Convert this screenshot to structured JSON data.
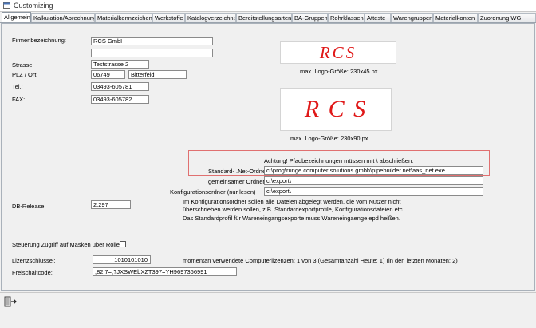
{
  "window": {
    "title": "Customizing"
  },
  "tabs": [
    "Allgemein",
    "Kalkulation/Abrechnung",
    "Materialkennzeichen",
    "Werkstoffe",
    "Katalogverzeichnis",
    "Bereitstellungsarten",
    "BA-Gruppen",
    "Rohrklassen",
    "Atteste",
    "Warengruppen",
    "Materialkonten",
    "Zuordnung WG"
  ],
  "form": {
    "firmenbezeichnung_label": "Firmenbezeichnung:",
    "firmenbezeichnung": "RCS GmbH",
    "firmenbezeichnung2": "",
    "strasse_label": "Strasse:",
    "strasse": "Teststrasse 2",
    "plz_ort_label": "PLZ / Ort:",
    "plz": "06749",
    "ort": "Bitterfeld",
    "tel_label": "Tel.:",
    "tel": "03493-605781",
    "fax_label": "FAX:",
    "fax": "03493-605782"
  },
  "logos": {
    "small_text": "RCS",
    "small_caption": "max. Logo-Größe: 230x45 px",
    "large_text": "R C S",
    "large_caption": "max. Logo-Größe: 230x90 px"
  },
  "paths": {
    "warning": "Achtung! Pfadbezeichnungen müssen mit \\ abschließen.",
    "net_label": "Standard- .Net-Ordner",
    "net_value": "c:\\prog\\runge computer solutions gmbh\\pipebuilder.net\\aas_net.exe",
    "shared_label": "gemeinsamer Ordner",
    "shared_value": "c:\\export\\",
    "config_label": "Konfigurationsordner (nur lesen)",
    "config_value": "c:\\export\\"
  },
  "db": {
    "label": "DB-Release:",
    "value": "2.297",
    "info1": "Im Konfigurationsordner sollen alle Dateien abgelegt werden, die vom Nutzer nicht",
    "info2": "überschrieben werden sollen, z.B. Standardexportprofile, Konfigurationsdateien etc.",
    "info3": "Das Standardprofil für Wareneingangsexporte muss Wareneingaenge.epd heißen."
  },
  "access": {
    "label": "Steuerung Zugriff auf Masken über Rollen",
    "checked": false
  },
  "license": {
    "key_label": "Lizenzschlüssel:",
    "key_value": "1010101010",
    "usage": "momentan verwendete Computerlizenzen: 1 von 3  (Gesamtanzahl Heute: 1)  (in den letzten Monaten: 2)",
    "code_label": "Freischaltcode:",
    "code_value": ";82:7=;?JXSWEbXZT397=YH9697366991"
  },
  "colors": {
    "logo_red": "#e01818",
    "warn_border": "#e07070"
  },
  "icons": {
    "window": "form-icon",
    "exit": "exit-door-icon"
  }
}
